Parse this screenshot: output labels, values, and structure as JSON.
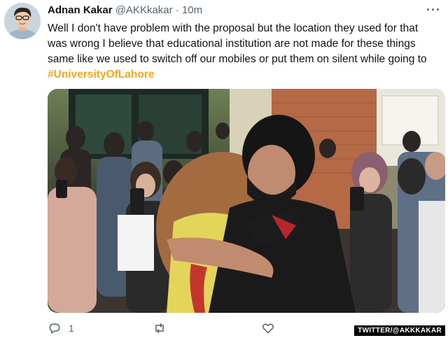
{
  "tweet": {
    "author_name": "Adnan Kakar",
    "author_handle": "@AKKkakar",
    "separator": "·",
    "timestamp": "10m",
    "more_label": "···",
    "text_before_hashtag": "Well I don't have problem with the proposal but the location they used for that was wrong I believe that educational institution are not made for these things same like we used to switch off our mobiles or put them on silent while going to ",
    "hashtag": "#UniversityOfLahore",
    "hashtag_color": "#f5a623"
  },
  "actions": {
    "reply_count": "1",
    "retweet_count": "",
    "like_count": ""
  },
  "icons": {
    "reply": "reply-icon",
    "retweet": "retweet-icon",
    "like": "heart-icon",
    "share": "share-icon",
    "more": "more-icon"
  },
  "watermark": "TWITTER/@AKKKAKAR"
}
